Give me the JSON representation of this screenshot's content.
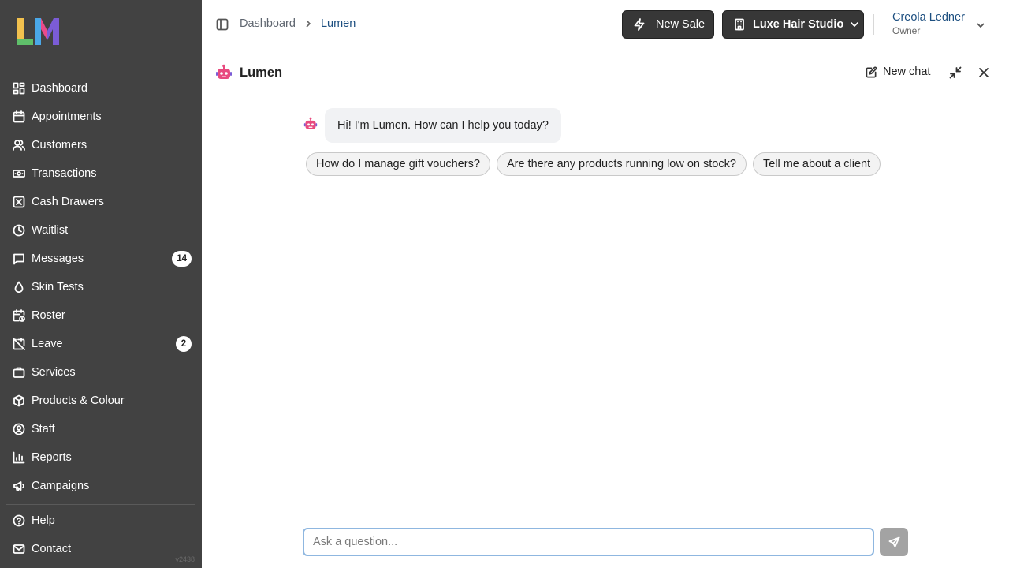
{
  "brand": {
    "logo_text": "LM"
  },
  "sidebar": {
    "items": [
      {
        "label": "Dashboard",
        "icon": "dashboard-icon"
      },
      {
        "label": "Appointments",
        "icon": "calendar-icon"
      },
      {
        "label": "Customers",
        "icon": "users-icon"
      },
      {
        "label": "Transactions",
        "icon": "banknote-icon"
      },
      {
        "label": "Cash Drawers",
        "icon": "cash-drawer-icon"
      },
      {
        "label": "Waitlist",
        "icon": "clock-icon"
      },
      {
        "label": "Messages",
        "icon": "message-icon",
        "badge": "14"
      },
      {
        "label": "Skin Tests",
        "icon": "droplet-icon"
      },
      {
        "label": "Roster",
        "icon": "calendar-clock-icon"
      },
      {
        "label": "Leave",
        "icon": "calendar-off-icon",
        "badge": "2"
      },
      {
        "label": "Services",
        "icon": "briefcase-icon"
      },
      {
        "label": "Products & Colour",
        "icon": "package-icon"
      },
      {
        "label": "Staff",
        "icon": "user-circle-icon"
      },
      {
        "label": "Reports",
        "icon": "bar-chart-icon"
      },
      {
        "label": "Campaigns",
        "icon": "megaphone-icon"
      }
    ],
    "bottom_items": [
      {
        "label": "Help",
        "icon": "help-circle-icon"
      },
      {
        "label": "Contact",
        "icon": "mail-icon"
      }
    ],
    "version": "v2438"
  },
  "topbar": {
    "breadcrumb": [
      "Dashboard",
      "Lumen"
    ],
    "new_sale_label": "New Sale",
    "studio_label": "Luxe Hair Studio",
    "user_name": "Creola Ledner",
    "user_role": "Owner"
  },
  "chat": {
    "title": "Lumen",
    "new_chat_label": "New chat",
    "greeting": "Hi! I'm Lumen. How can I help you today?",
    "suggestions": [
      "How do I manage gift vouchers?",
      "Are there any products running low on stock?",
      "Tell me about a client"
    ],
    "input_placeholder": "Ask a question..."
  },
  "colors": {
    "sidebar_bg": "#424242",
    "link_blue": "#1d4f80",
    "input_focus": "#8fb7e0",
    "send_disabled": "#a3a3a3"
  }
}
